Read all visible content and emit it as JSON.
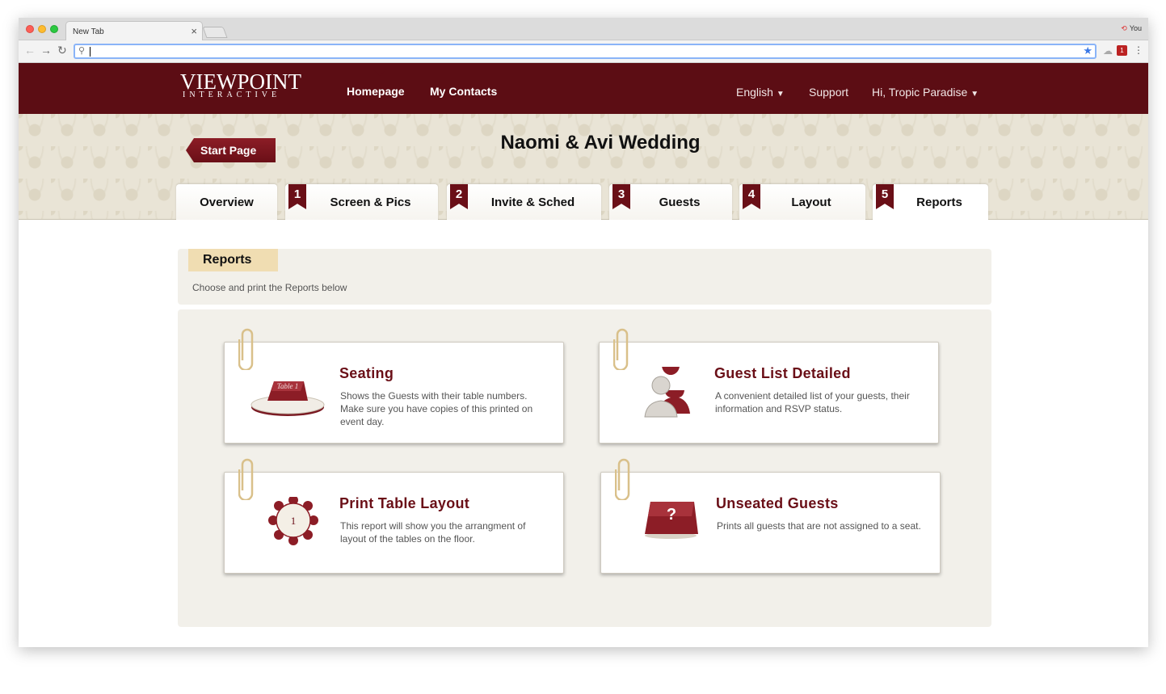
{
  "browser": {
    "tab_title": "New Tab",
    "tab_close": "×",
    "profile_name": "You",
    "address_value": "",
    "back_glyph": "←",
    "forward_glyph": "→",
    "reload_glyph": "↻",
    "star_glyph": "★",
    "menu_glyph": "⋮"
  },
  "header": {
    "logo_main": "VIEWPOINT",
    "logo_sub": "INTERACTIVE",
    "nav": [
      {
        "label": "Homepage"
      },
      {
        "label": "My Contacts"
      }
    ],
    "language": "English",
    "support": "Support",
    "user_greeting": "Hi, Tropic Paradise",
    "caret": "▼",
    "colors": {
      "header_bg": "#5c0d14",
      "accent": "#6a0f17",
      "reports_label_bg": "#f0ddb2"
    }
  },
  "banner": {
    "start_page": "Start Page",
    "event_title": "Naomi & Avi Wedding"
  },
  "steps": [
    {
      "num": "",
      "label": "Overview"
    },
    {
      "num": "1",
      "label": "Screen & Pics"
    },
    {
      "num": "2",
      "label": "Invite & Sched"
    },
    {
      "num": "3",
      "label": "Guests"
    },
    {
      "num": "4",
      "label": "Layout"
    },
    {
      "num": "5",
      "label": "Reports",
      "active": true
    }
  ],
  "reports": {
    "section_label": "Reports",
    "description": "Choose and print the Reports below",
    "cards": [
      {
        "title": "Seating",
        "description": "Shows the Guests with their table numbers. Make sure you have copies of this printed on event day.",
        "icon": "table-card-icon",
        "icon_text": "Table 1"
      },
      {
        "title": "Guest List Detailed",
        "description": "A convenient detailed list of your guests, their information and RSVP status.",
        "icon": "guests-silhouette-icon"
      },
      {
        "title": "Print Table Layout",
        "description": "This report will show you the arrangment of layout of the tables on the floor.",
        "icon": "round-table-icon",
        "icon_text": "1"
      },
      {
        "title": "Unseated Guests",
        "description": "Prints all guests that are not assigned to a seat.",
        "icon": "question-card-icon",
        "icon_text": "?"
      }
    ]
  }
}
